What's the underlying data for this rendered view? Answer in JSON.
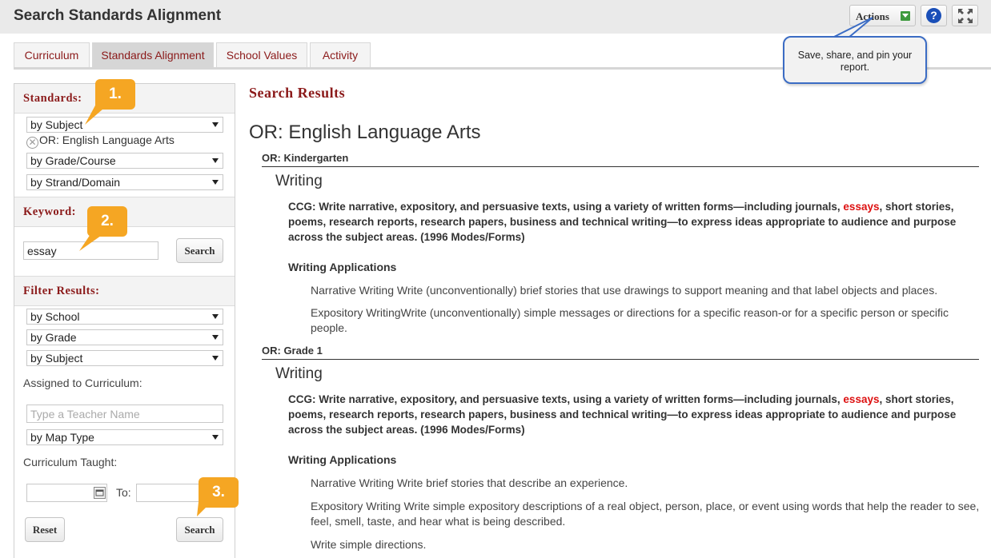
{
  "header": {
    "title": "Search Standards Alignment",
    "actions_label": "Actions",
    "help_label": "?"
  },
  "tabs": [
    {
      "label": "Curriculum",
      "active": false
    },
    {
      "label": "Standards Alignment",
      "active": true
    },
    {
      "label": "School Values",
      "active": false
    },
    {
      "label": "Activity",
      "active": false
    }
  ],
  "tooltip": "Save, share, and pin your report.",
  "sidebar": {
    "standards": {
      "heading": "Standards:",
      "subject_select": "by Subject",
      "selected_subject": "OR: English Language Arts",
      "grade_select": "by Grade/Course",
      "strand_select": "by Strand/Domain"
    },
    "keyword": {
      "heading": "Keyword:",
      "value": "essay",
      "search_label": "Search"
    },
    "filter": {
      "heading": "Filter Results:",
      "school_select": "by School",
      "grade_select": "by Grade",
      "subject_select": "by Subject",
      "assigned_label": "Assigned to Curriculum:",
      "teacher_placeholder": "Type a Teacher Name",
      "map_type_select": "by Map Type",
      "taught_label": "Curriculum Taught:",
      "to_label": "To:",
      "reset_label": "Reset",
      "search_label": "Search"
    }
  },
  "callouts": [
    "1.",
    "2.",
    "3."
  ],
  "results": {
    "title": "Search Results",
    "subject": "OR: English Language Arts",
    "grades": [
      {
        "name": "OR: Kindergarten",
        "strand": "Writing",
        "standard_pre": "CCG: Write narrative, expository, and persuasive texts, using a variety of written forms—including journals, ",
        "standard_hl": "essays",
        "standard_post": ", short stories, poems, research reports, research papers, business and technical writing—to express ideas appropriate to audience and purpose across the subject areas. (1996 Modes/Forms)",
        "applications_head": "Writing Applications",
        "items": [
          "Narrative Writing Write (unconventionally) brief stories that use drawings to support meaning and that label objects and places.",
          "Expository WritingWrite (unconventionally) simple messages or directions for a specific reason-or for a specific person or specific people."
        ]
      },
      {
        "name": "OR: Grade 1",
        "strand": "Writing",
        "standard_pre": "CCG: Write narrative, expository, and persuasive texts, using a variety of written forms—including journals, ",
        "standard_hl": "essays",
        "standard_post": ", short stories, poems, research reports, research papers, business and technical writing—to express ideas appropriate to audience and purpose across the subject areas. (1996 Modes/Forms)",
        "applications_head": "Writing Applications",
        "items": [
          "Narrative Writing Write brief stories that describe an experience.",
          "Expository Writing Write simple expository descriptions of a real object, person, place, or event using words that help the reader to see, feel, smell, taste, and hear what is being described.",
          "Write simple directions."
        ]
      }
    ]
  }
}
